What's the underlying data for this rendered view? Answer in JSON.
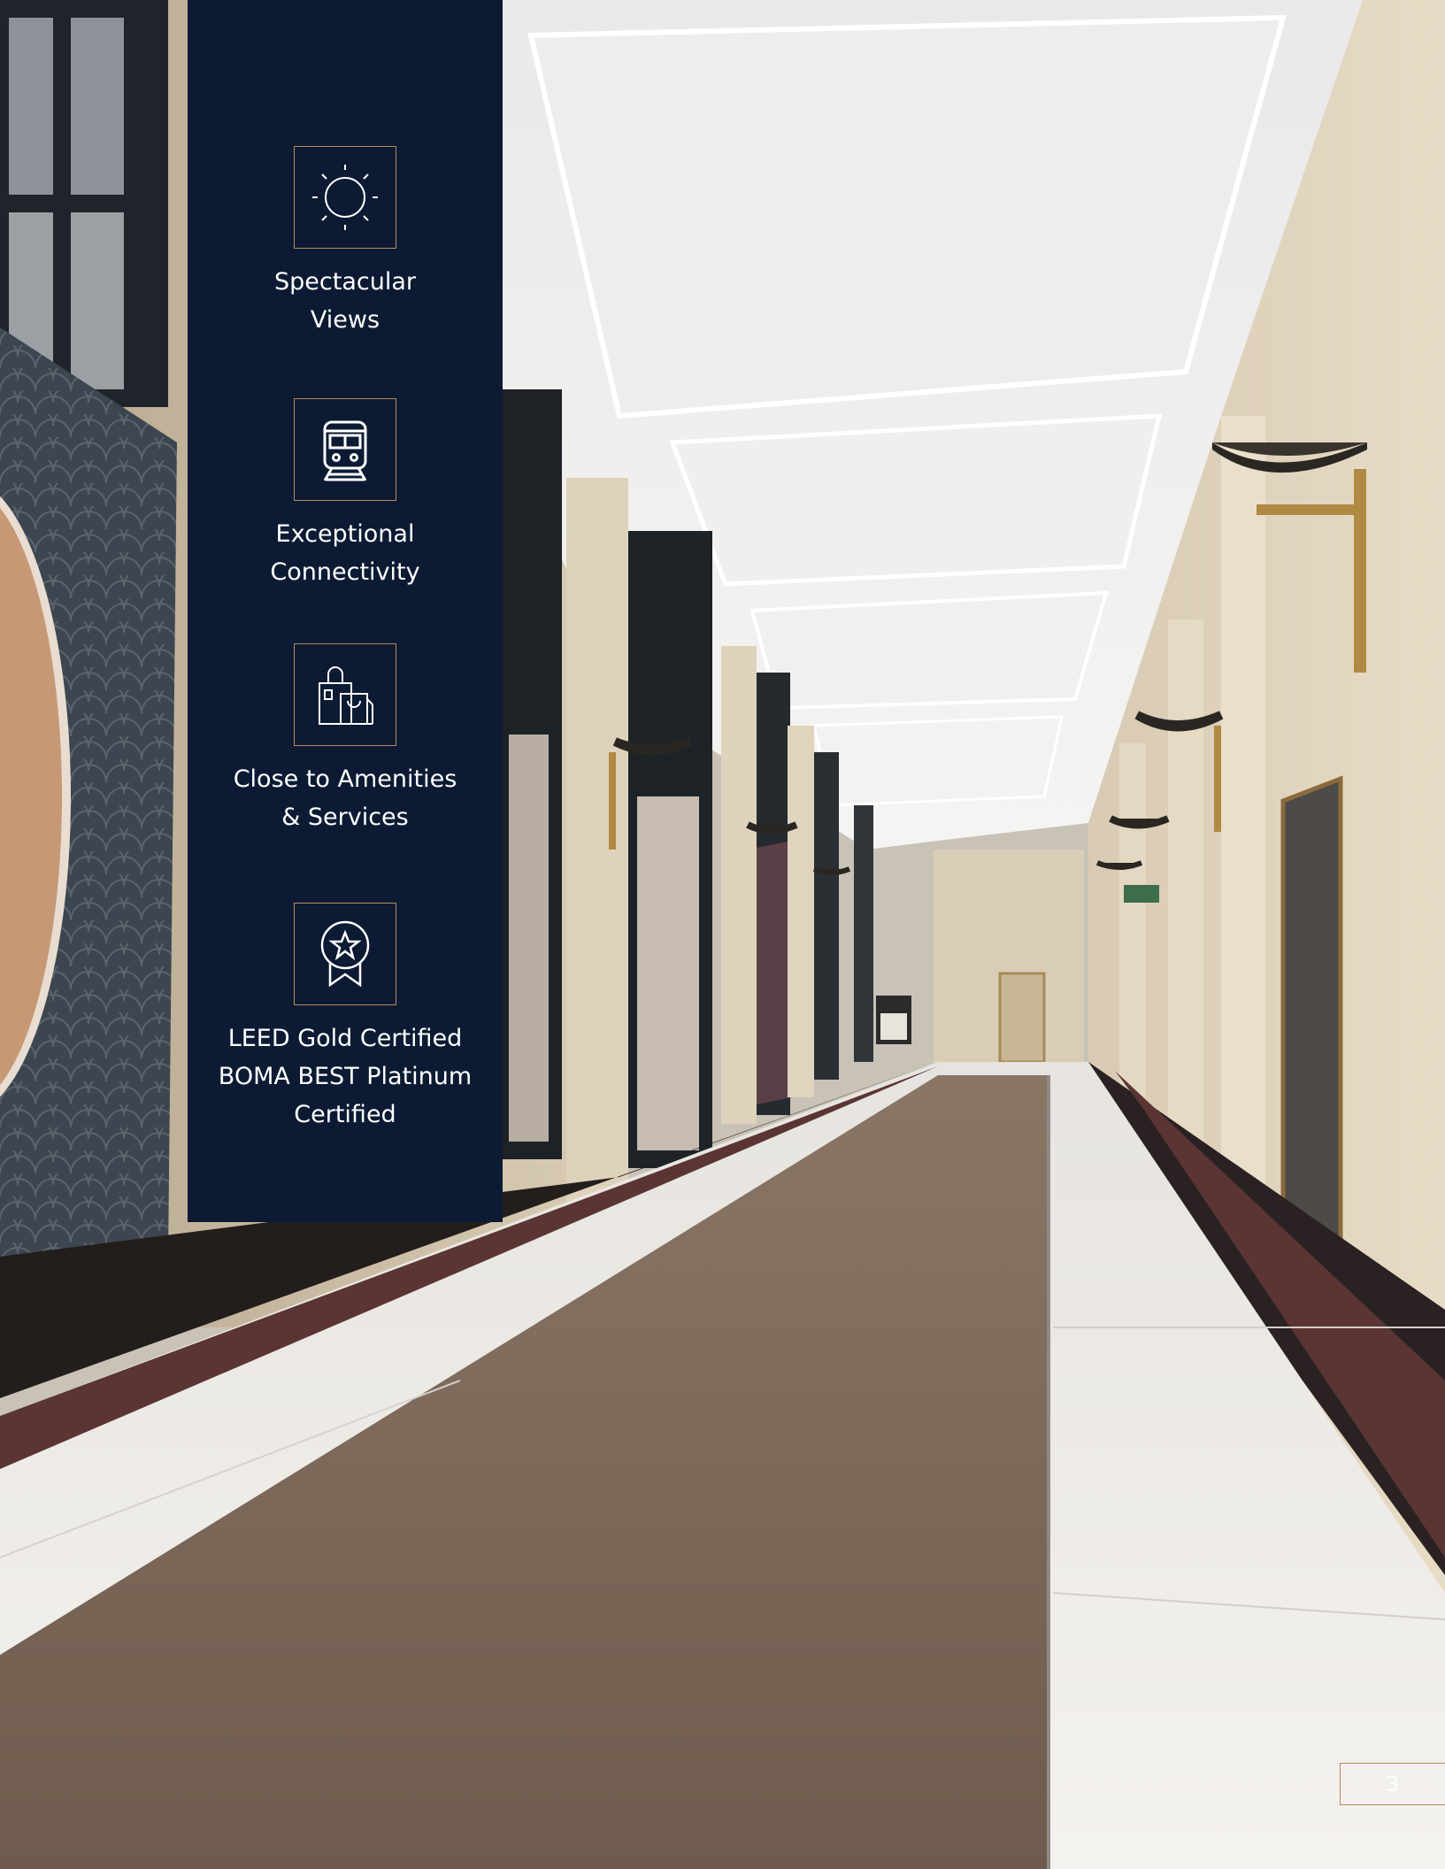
{
  "panel": {
    "background": "#0c1b33",
    "accent": "#b48a5c",
    "features": [
      {
        "icon": "sun-icon",
        "lines": [
          "Spectacular",
          "Views"
        ]
      },
      {
        "icon": "train-icon",
        "lines": [
          "Exceptional",
          "Connectivity"
        ]
      },
      {
        "icon": "shopping-bags-icon",
        "lines": [
          "Close to Amenities",
          "& Services"
        ]
      },
      {
        "icon": "award-ribbon-icon",
        "lines": [
          "LEED Gold Certified",
          "BOMA BEST Platinum",
          "Certified"
        ]
      }
    ]
  },
  "page_number": "3"
}
